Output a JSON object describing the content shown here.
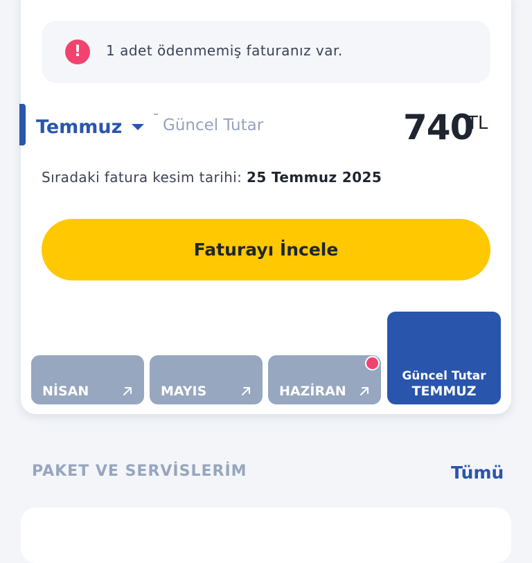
{
  "alert": {
    "icon": "exclamation-icon",
    "icon_glyph": "!",
    "message": "1 adet ödenmemiş faturanız var.",
    "icon_color": "#f2436e"
  },
  "bill": {
    "month": "Temmuz",
    "current_label": "Güncel Tutar",
    "amount": "740",
    "currency": "TL",
    "next_bill_label": "Sıradaki fatura kesim tarihi:",
    "next_bill_date": "25 Temmuz 2025",
    "review_button": "Faturayı İncele",
    "accent_color": "#2a55ad",
    "button_color": "#ffc800"
  },
  "month_tabs": [
    {
      "label": "NİSAN",
      "icon": "arrow-up-right-icon",
      "has_notification": false
    },
    {
      "label": "MAYIS",
      "icon": "arrow-up-right-icon",
      "has_notification": false
    },
    {
      "label": "HAZİRAN",
      "icon": "arrow-up-right-icon",
      "has_notification": true
    }
  ],
  "active_tab": {
    "sub_label": "Güncel Tutar",
    "label": "TEMMUZ"
  },
  "section": {
    "title": "PAKET VE SERVİSLERİM",
    "see_all": "Tümü"
  }
}
